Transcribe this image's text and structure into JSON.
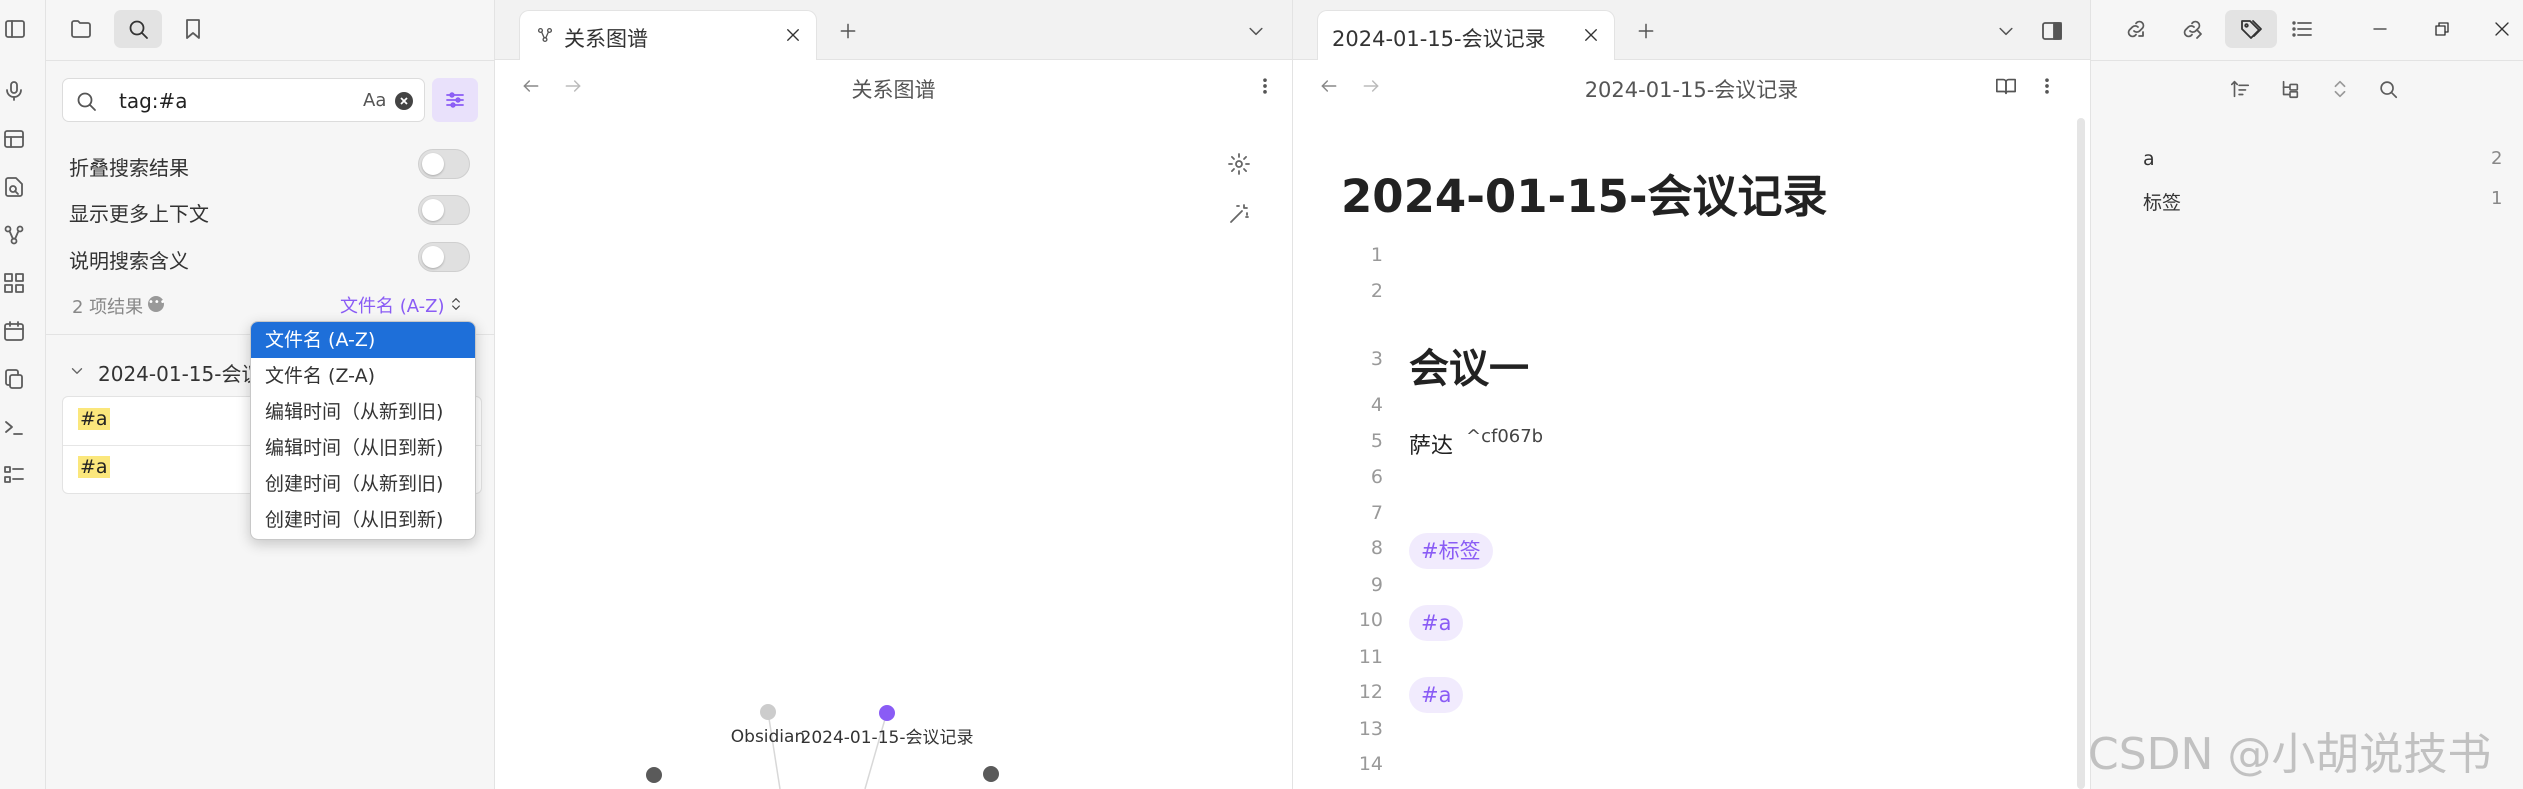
{
  "left_panel": {
    "search": {
      "value": "tag:#a",
      "case_label": "Aa"
    },
    "options": [
      {
        "label": "折叠搜索结果"
      },
      {
        "label": "显示更多上下文"
      },
      {
        "label": "说明搜索含义"
      }
    ],
    "results_count": "2 项结果",
    "sort_label": "文件名 (A-Z)",
    "result_file": "2024-01-15-会议",
    "matches": [
      "#a",
      "#a"
    ],
    "sort_menu": [
      "文件名 (A-Z)",
      "文件名 (Z-A)",
      "编辑时间（从新到旧)",
      "编辑时间（从旧到新)",
      "创建时间（从新到旧)",
      "创建时间（从旧到新)"
    ]
  },
  "graph_pane": {
    "tab_title": "关系图谱",
    "nav_title": "关系图谱",
    "nodes": [
      {
        "label": "Obsidian",
        "color": "#cccccc"
      },
      {
        "label": "2024-01-15-会议记录",
        "color": "#8a5cf5"
      }
    ]
  },
  "note_pane": {
    "tab_title": "2024-01-15-会议记录",
    "nav_title": "2024-01-15-会议记录",
    "inline_title": "2024-01-15-会议记录",
    "line_numbers": [
      "1",
      "2",
      "3",
      "4",
      "5",
      "6",
      "7",
      "8",
      "9",
      "10",
      "11",
      "12",
      "13",
      "14"
    ],
    "heading": "会议一",
    "body_text": "萨达",
    "block_ref": "^cf067b",
    "tags": [
      "#标签",
      "#a",
      "#a"
    ]
  },
  "right_panel": {
    "tags": [
      {
        "name": "a",
        "count": "2"
      },
      {
        "name": "标签",
        "count": "1"
      }
    ]
  },
  "watermark": "CSDN @小胡说技书",
  "colors": {
    "accent": "#8a5cf5",
    "selection": "#1e6fd9",
    "highlight": "#fbe77c"
  }
}
